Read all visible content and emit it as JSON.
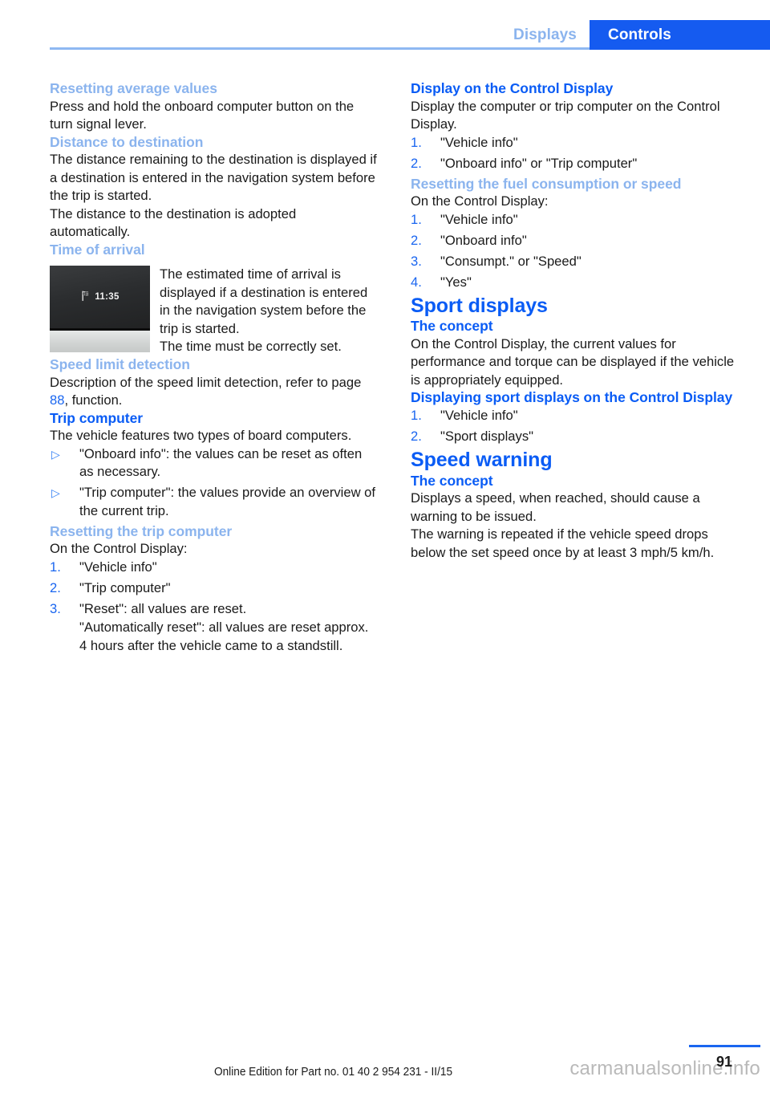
{
  "header": {
    "inactive_tab": "Displays",
    "active_tab": "Controls",
    "active_color": "#155bf0",
    "inactive_color": "#8bb4ee"
  },
  "left_column": {
    "s1": {
      "heading": "Resetting average values",
      "p1": "Press and hold the onboard computer button on the turn signal lever."
    },
    "s2": {
      "heading": "Distance to destination",
      "p1": "The distance remaining to the destination is displayed if a destination is entered in the navigation system before the trip is started.",
      "p2": "The distance to the destination is adopted automatically."
    },
    "s3": {
      "heading": "Time of arrival",
      "figure": {
        "icon": "checkered-flag-icon",
        "time": "11:35"
      },
      "p1": "The estimated time of arrival is displayed if a destination is entered in the navigation system before the trip is started.",
      "p2": "The time must be correctly set."
    },
    "s4": {
      "heading": "Speed limit detection",
      "p1_before": "Description of the speed limit detection, refer to page ",
      "p1_ref": "88",
      "p1_after": ", function."
    },
    "s5": {
      "heading": "Trip computer",
      "p1": "The vehicle features two types of board computers.",
      "bullets": [
        "\"Onboard info\": the values can be reset as often as necessary.",
        "\"Trip computer\": the values provide an overview of the current trip."
      ]
    },
    "s6": {
      "heading": "Resetting the trip computer",
      "p1": "On the Control Display:",
      "steps": [
        {
          "num": "1.",
          "text": "\"Vehicle info\""
        },
        {
          "num": "2.",
          "text": "\"Trip computer\""
        },
        {
          "num": "3.",
          "text": "\"Reset\": all values are reset."
        }
      ],
      "step3_extra": "\"Automatically reset\": all values are reset approx. 4 hours after the vehicle came to a standstill."
    }
  },
  "right_column": {
    "s1": {
      "heading": "Display on the Control Display",
      "p1": "Display the computer or trip computer on the Control Display.",
      "steps": [
        {
          "num": "1.",
          "text": "\"Vehicle info\""
        },
        {
          "num": "2.",
          "text": "\"Onboard info\" or \"Trip computer\""
        }
      ]
    },
    "s2": {
      "heading": "Resetting the fuel consumption or speed",
      "p1": "On the Control Display:",
      "steps": [
        {
          "num": "1.",
          "text": "\"Vehicle info\""
        },
        {
          "num": "2.",
          "text": "\"Onboard info\""
        },
        {
          "num": "3.",
          "text": "\"Consumpt.\" or \"Speed\""
        },
        {
          "num": "4.",
          "text": "\"Yes\""
        }
      ]
    },
    "s3": {
      "title": "Sport displays",
      "sub1_heading": "The concept",
      "sub1_p1": "On the Control Display, the current values for performance and torque can be displayed if the vehicle is appropriately equipped.",
      "sub2_heading": "Displaying sport displays on the Control Display",
      "sub2_steps": [
        {
          "num": "1.",
          "text": "\"Vehicle info\""
        },
        {
          "num": "2.",
          "text": "\"Sport displays\""
        }
      ]
    },
    "s4": {
      "title": "Speed warning",
      "sub1_heading": "The concept",
      "sub1_p1": "Displays a speed, when reached, should cause a warning to be issued.",
      "sub1_p2": "The warning is repeated if the vehicle speed drops below the set speed once by at least 3 mph/5 km/h."
    }
  },
  "footer": {
    "edition": "Online Edition for Part no. 01 40 2 954 231 - II/15",
    "watermark": "carmanualsonline.info",
    "page_number": "91"
  }
}
